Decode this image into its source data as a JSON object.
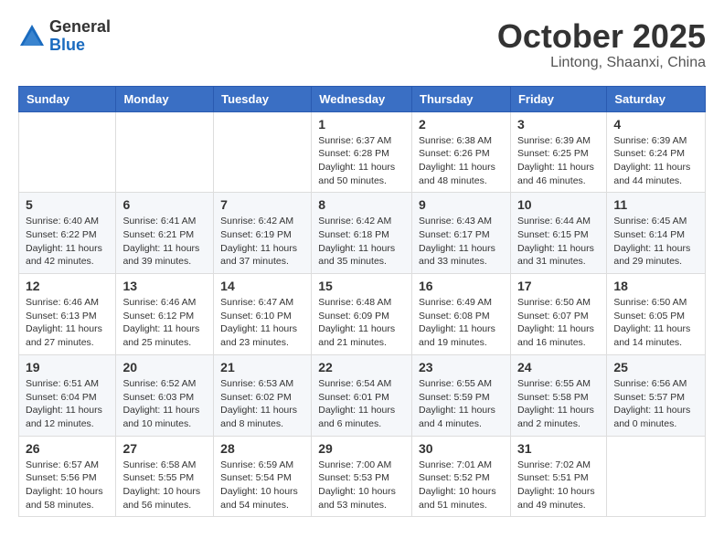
{
  "header": {
    "logo_general": "General",
    "logo_blue": "Blue",
    "month_title": "October 2025",
    "location": "Lintong, Shaanxi, China"
  },
  "weekdays": [
    "Sunday",
    "Monday",
    "Tuesday",
    "Wednesday",
    "Thursday",
    "Friday",
    "Saturday"
  ],
  "weeks": [
    [
      {
        "day": "",
        "info": ""
      },
      {
        "day": "",
        "info": ""
      },
      {
        "day": "",
        "info": ""
      },
      {
        "day": "1",
        "info": "Sunrise: 6:37 AM\nSunset: 6:28 PM\nDaylight: 11 hours\nand 50 minutes."
      },
      {
        "day": "2",
        "info": "Sunrise: 6:38 AM\nSunset: 6:26 PM\nDaylight: 11 hours\nand 48 minutes."
      },
      {
        "day": "3",
        "info": "Sunrise: 6:39 AM\nSunset: 6:25 PM\nDaylight: 11 hours\nand 46 minutes."
      },
      {
        "day": "4",
        "info": "Sunrise: 6:39 AM\nSunset: 6:24 PM\nDaylight: 11 hours\nand 44 minutes."
      }
    ],
    [
      {
        "day": "5",
        "info": "Sunrise: 6:40 AM\nSunset: 6:22 PM\nDaylight: 11 hours\nand 42 minutes."
      },
      {
        "day": "6",
        "info": "Sunrise: 6:41 AM\nSunset: 6:21 PM\nDaylight: 11 hours\nand 39 minutes."
      },
      {
        "day": "7",
        "info": "Sunrise: 6:42 AM\nSunset: 6:19 PM\nDaylight: 11 hours\nand 37 minutes."
      },
      {
        "day": "8",
        "info": "Sunrise: 6:42 AM\nSunset: 6:18 PM\nDaylight: 11 hours\nand 35 minutes."
      },
      {
        "day": "9",
        "info": "Sunrise: 6:43 AM\nSunset: 6:17 PM\nDaylight: 11 hours\nand 33 minutes."
      },
      {
        "day": "10",
        "info": "Sunrise: 6:44 AM\nSunset: 6:15 PM\nDaylight: 11 hours\nand 31 minutes."
      },
      {
        "day": "11",
        "info": "Sunrise: 6:45 AM\nSunset: 6:14 PM\nDaylight: 11 hours\nand 29 minutes."
      }
    ],
    [
      {
        "day": "12",
        "info": "Sunrise: 6:46 AM\nSunset: 6:13 PM\nDaylight: 11 hours\nand 27 minutes."
      },
      {
        "day": "13",
        "info": "Sunrise: 6:46 AM\nSunset: 6:12 PM\nDaylight: 11 hours\nand 25 minutes."
      },
      {
        "day": "14",
        "info": "Sunrise: 6:47 AM\nSunset: 6:10 PM\nDaylight: 11 hours\nand 23 minutes."
      },
      {
        "day": "15",
        "info": "Sunrise: 6:48 AM\nSunset: 6:09 PM\nDaylight: 11 hours\nand 21 minutes."
      },
      {
        "day": "16",
        "info": "Sunrise: 6:49 AM\nSunset: 6:08 PM\nDaylight: 11 hours\nand 19 minutes."
      },
      {
        "day": "17",
        "info": "Sunrise: 6:50 AM\nSunset: 6:07 PM\nDaylight: 11 hours\nand 16 minutes."
      },
      {
        "day": "18",
        "info": "Sunrise: 6:50 AM\nSunset: 6:05 PM\nDaylight: 11 hours\nand 14 minutes."
      }
    ],
    [
      {
        "day": "19",
        "info": "Sunrise: 6:51 AM\nSunset: 6:04 PM\nDaylight: 11 hours\nand 12 minutes."
      },
      {
        "day": "20",
        "info": "Sunrise: 6:52 AM\nSunset: 6:03 PM\nDaylight: 11 hours\nand 10 minutes."
      },
      {
        "day": "21",
        "info": "Sunrise: 6:53 AM\nSunset: 6:02 PM\nDaylight: 11 hours\nand 8 minutes."
      },
      {
        "day": "22",
        "info": "Sunrise: 6:54 AM\nSunset: 6:01 PM\nDaylight: 11 hours\nand 6 minutes."
      },
      {
        "day": "23",
        "info": "Sunrise: 6:55 AM\nSunset: 5:59 PM\nDaylight: 11 hours\nand 4 minutes."
      },
      {
        "day": "24",
        "info": "Sunrise: 6:55 AM\nSunset: 5:58 PM\nDaylight: 11 hours\nand 2 minutes."
      },
      {
        "day": "25",
        "info": "Sunrise: 6:56 AM\nSunset: 5:57 PM\nDaylight: 11 hours\nand 0 minutes."
      }
    ],
    [
      {
        "day": "26",
        "info": "Sunrise: 6:57 AM\nSunset: 5:56 PM\nDaylight: 10 hours\nand 58 minutes."
      },
      {
        "day": "27",
        "info": "Sunrise: 6:58 AM\nSunset: 5:55 PM\nDaylight: 10 hours\nand 56 minutes."
      },
      {
        "day": "28",
        "info": "Sunrise: 6:59 AM\nSunset: 5:54 PM\nDaylight: 10 hours\nand 54 minutes."
      },
      {
        "day": "29",
        "info": "Sunrise: 7:00 AM\nSunset: 5:53 PM\nDaylight: 10 hours\nand 53 minutes."
      },
      {
        "day": "30",
        "info": "Sunrise: 7:01 AM\nSunset: 5:52 PM\nDaylight: 10 hours\nand 51 minutes."
      },
      {
        "day": "31",
        "info": "Sunrise: 7:02 AM\nSunset: 5:51 PM\nDaylight: 10 hours\nand 49 minutes."
      },
      {
        "day": "",
        "info": ""
      }
    ]
  ]
}
